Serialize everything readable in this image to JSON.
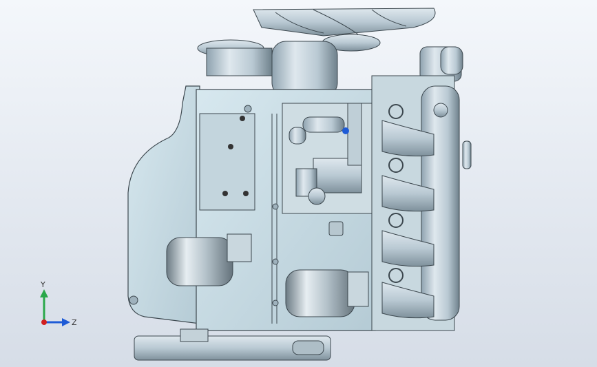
{
  "viewport": {
    "background_top": "#f4f7fb",
    "background_bottom": "#d6dde7"
  },
  "model": {
    "metal_color": "#b9c9d3",
    "metal_dark": "#5b6a73",
    "accent_green": "#2aa84a",
    "accent_blue": "#1e5bd6"
  },
  "triad": {
    "y_label": "Y",
    "z_label": "Z",
    "y_color": "#2aa84a",
    "z_color": "#1e5bd6",
    "x_color": "#d11f1f"
  }
}
